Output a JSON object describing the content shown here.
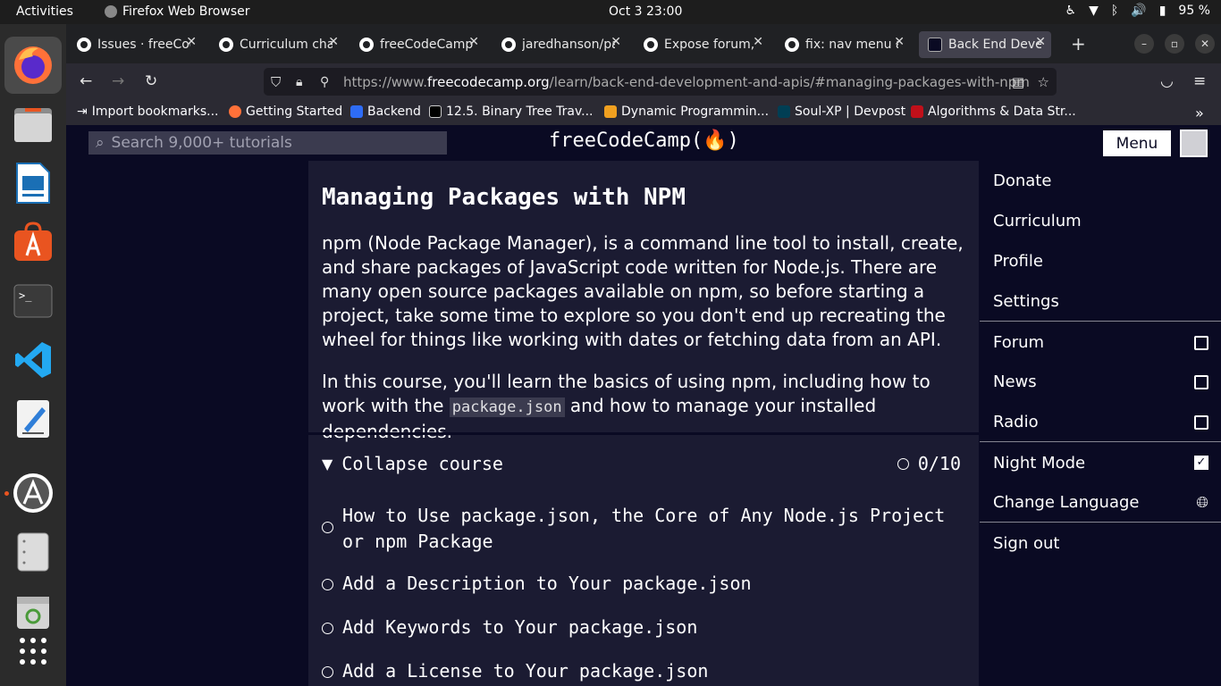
{
  "system": {
    "activities": "Activities",
    "app_name": "Firefox Web Browser",
    "clock": "Oct 3  23:00",
    "battery": "95 %"
  },
  "tabs": [
    {
      "title": "Issues · freeCodeCamp",
      "icon": "github-icon"
    },
    {
      "title": "Curriculum challenges",
      "icon": "github-icon"
    },
    {
      "title": "freeCodeCamp/freeCodeCamp",
      "icon": "github-icon"
    },
    {
      "title": "jaredhanson/passport",
      "icon": "github-icon"
    },
    {
      "title": "Expose forum, news",
      "icon": "github-icon"
    },
    {
      "title": "fix: nav menu accessibility",
      "icon": "github-icon"
    },
    {
      "title": "Back End Development",
      "icon": "freecodecamp-icon"
    }
  ],
  "url": {
    "prefix": "https://www.",
    "domain": "freecodecamp.org",
    "path": "/learn/back-end-development-and-apis/#managing-packages-with-npm"
  },
  "bookmarks": [
    "Import bookmarks...",
    "Getting Started",
    "Backend",
    "12.5. Binary Tree Trav...",
    "Dynamic Programmin...",
    "Soul-XP | Devpost",
    "Algorithms & Data Str..."
  ],
  "site": {
    "search_placeholder": "Search 9,000+ tutorials",
    "logo": "freeCodeCamp(🔥)",
    "menu_label": "Menu"
  },
  "course": {
    "title": "Managing Packages with NPM",
    "intro": "npm (Node Package Manager), is a command line tool to install, create, and share packages of JavaScript code written for Node.js. There are many open source packages available on npm, so before starting a project, take some time to explore so you don't end up recreating the wheel for things like working with dates or fetching data from an API.",
    "para2_before": "In this course, you'll learn the basics of using npm, including how to work with the ",
    "para2_code": "package.json",
    "para2_after": " and how to manage your installed dependencies.",
    "collapse_label": "Collapse course",
    "progress": "0/10",
    "challenges": [
      "How to Use package.json, the Core of Any Node.js Project or npm Package",
      "Add a Description to Your package.json",
      "Add Keywords to Your package.json",
      "Add a License to Your package.json"
    ]
  },
  "menu": {
    "items_group1": [
      "Donate",
      "Curriculum",
      "Profile",
      "Settings"
    ],
    "items_group2": [
      "Forum",
      "News",
      "Radio"
    ],
    "night_mode": "Night Mode",
    "change_language": "Change Language",
    "sign_out": "Sign out"
  }
}
